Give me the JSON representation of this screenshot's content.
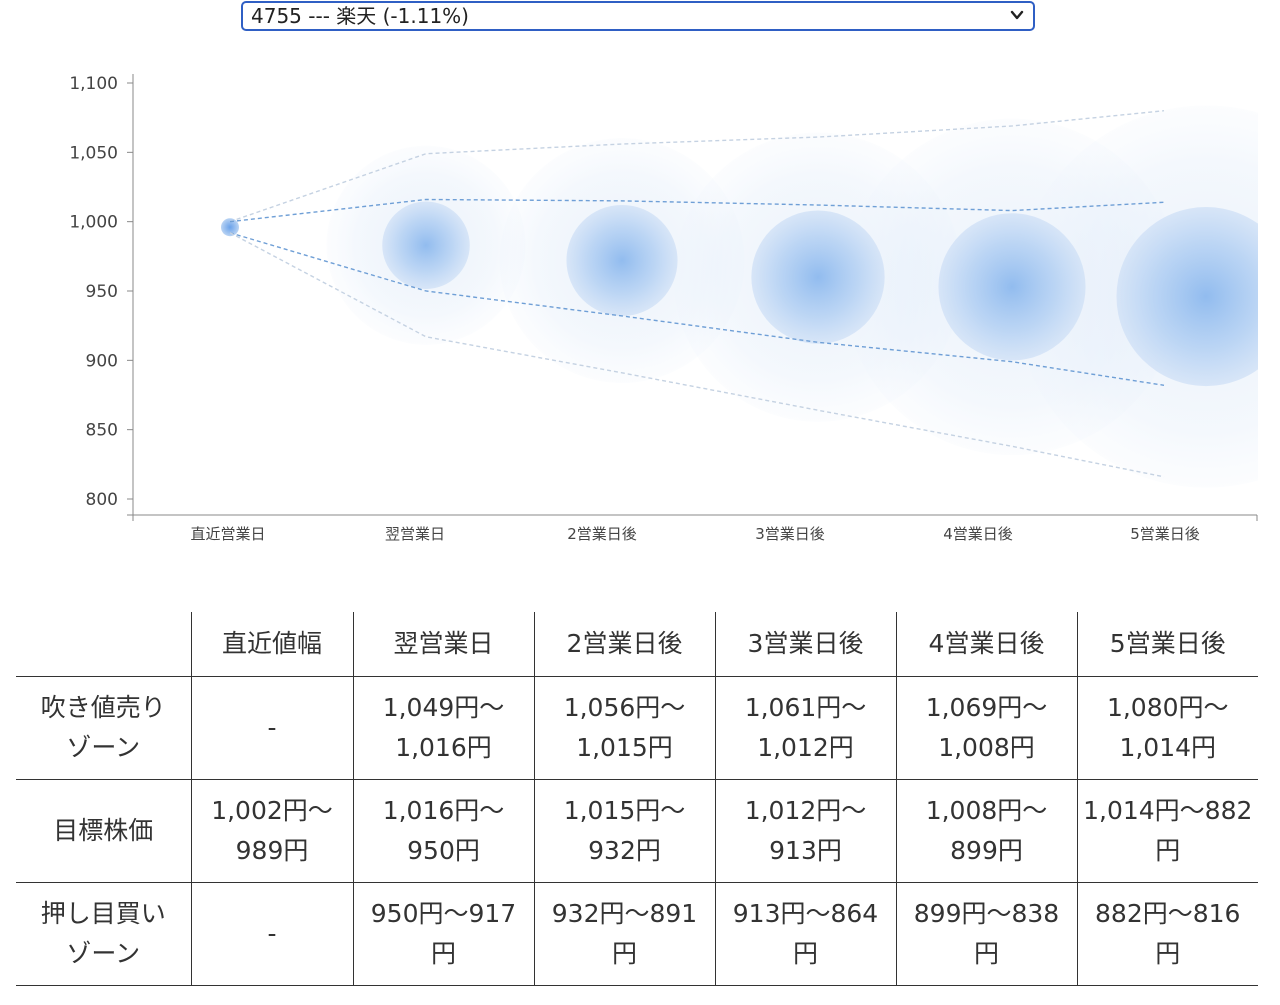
{
  "selector": {
    "selected": "4755 --- 楽天 (-1.11%)"
  },
  "chart_data": {
    "type": "scatter",
    "categories": [
      "直近営業日",
      "翌営業日",
      "2営業日後",
      "3営業日後",
      "4営業日後",
      "5営業日後"
    ],
    "ylim": [
      800,
      1100
    ],
    "y_ticks": [
      "1,100",
      "1,050",
      "1,000",
      "950",
      "900",
      "850",
      "800"
    ],
    "y_tick_values": [
      1100,
      1050,
      1000,
      950,
      900,
      850,
      800
    ],
    "series": [
      {
        "values": [
          996,
          983,
          972,
          960,
          953,
          946
        ]
      },
      {
        "values": [
          1000,
          1049,
          1056,
          1061,
          1069,
          1080
        ]
      },
      {
        "values": [
          1000,
          1016,
          1015,
          1012,
          1008,
          1014
        ]
      },
      {
        "values": [
          992,
          950,
          932,
          913,
          899,
          882
        ]
      },
      {
        "values": [
          992,
          917,
          891,
          864,
          838,
          816
        ]
      }
    ],
    "grid": false,
    "colors": {
      "point": "#4a8fe0",
      "line_inner": "#6f9fd6",
      "line_outer": "#c5d2e2",
      "axis": "#888888"
    }
  },
  "table": {
    "headers": [
      "",
      "直近値幅",
      "翌営業日",
      "2営業日後",
      "3営業日後",
      "4営業日後",
      "5営業日後"
    ],
    "rows": [
      {
        "label_lines": [
          "吹き値売り",
          "ゾーン"
        ],
        "cells": [
          [
            "-"
          ],
          [
            "1,049円〜",
            "1,016円"
          ],
          [
            "1,056円〜",
            "1,015円"
          ],
          [
            "1,061円〜",
            "1,012円"
          ],
          [
            "1,069円〜",
            "1,008円"
          ],
          [
            "1,080円〜",
            "1,014円"
          ]
        ]
      },
      {
        "label_lines": [
          "目標株価"
        ],
        "cells": [
          [
            "1,002円〜",
            "989円"
          ],
          [
            "1,016円〜",
            "950円"
          ],
          [
            "1,015円〜",
            "932円"
          ],
          [
            "1,012円〜",
            "913円"
          ],
          [
            "1,008円〜",
            "899円"
          ],
          [
            "1,014円〜882",
            "円"
          ]
        ]
      },
      {
        "label_lines": [
          "押し目買い",
          "ゾーン"
        ],
        "cells": [
          [
            "-"
          ],
          [
            "950円〜917",
            "円"
          ],
          [
            "932円〜891",
            "円"
          ],
          [
            "913円〜864",
            "円"
          ],
          [
            "899円〜838",
            "円"
          ],
          [
            "882円〜816",
            "円"
          ]
        ]
      }
    ]
  }
}
